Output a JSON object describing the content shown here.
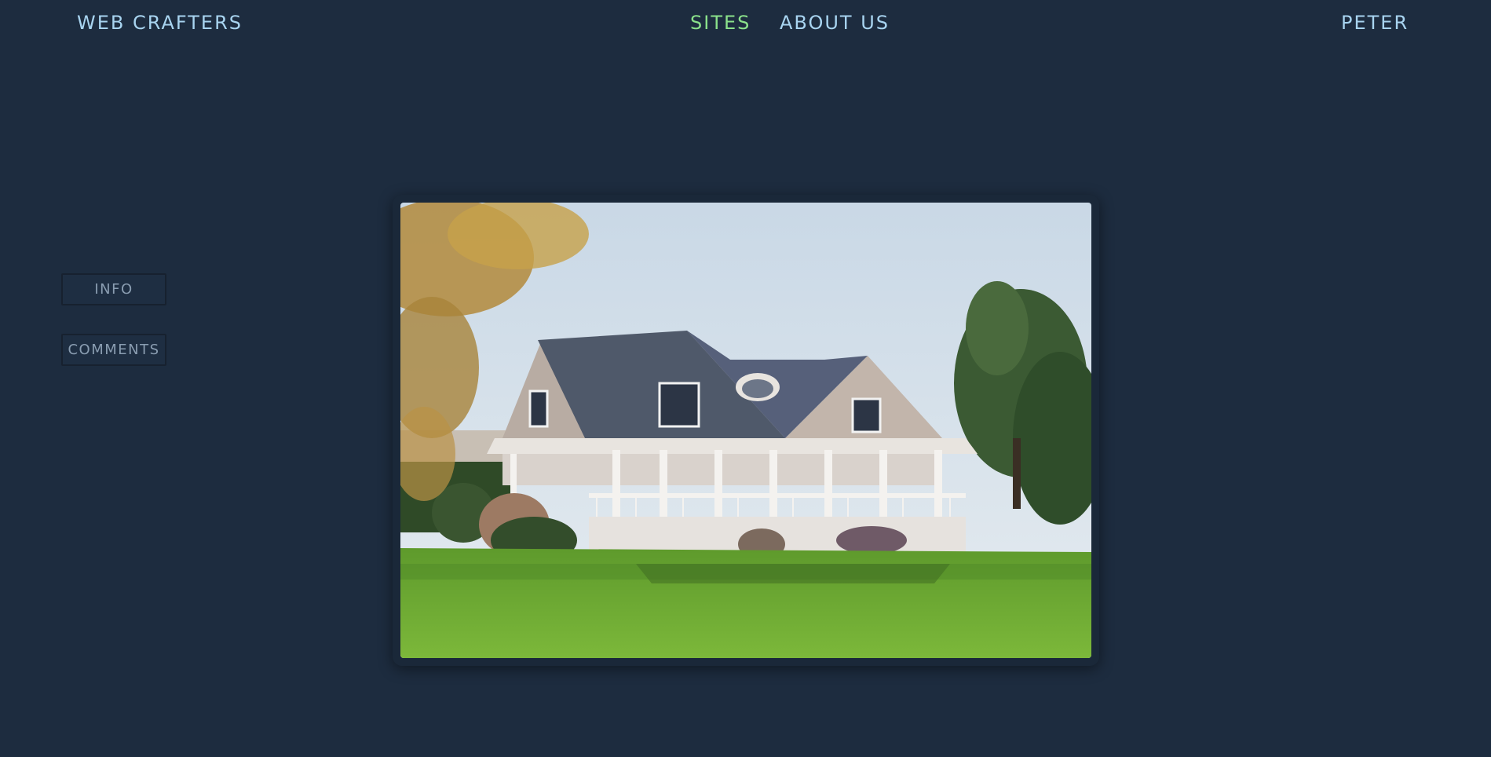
{
  "header": {
    "brand": "WEB CRAFTERS",
    "nav": [
      {
        "label": "SITES",
        "active": true
      },
      {
        "label": "ABOUT US",
        "active": false
      }
    ],
    "user": "PETER"
  },
  "sidebar": {
    "buttons": [
      {
        "label": "INFO"
      },
      {
        "label": "COMMENTS"
      }
    ]
  },
  "photo": {
    "description_icon": "house-photo"
  },
  "colors": {
    "background": "#1d2c3f",
    "nav_text": "#a8d4f0",
    "nav_active": "#8be28b",
    "button_text": "#8a9db1"
  }
}
